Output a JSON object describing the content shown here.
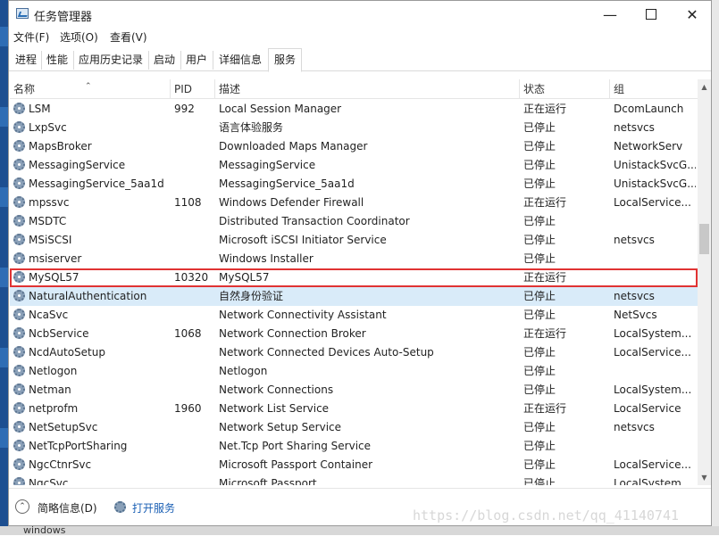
{
  "window": {
    "title": "任务管理器"
  },
  "menu": [
    "文件(F)",
    "选项(O)",
    "查看(V)"
  ],
  "tabs": [
    {
      "label": "进程",
      "active": false
    },
    {
      "label": "性能",
      "active": false
    },
    {
      "label": "应用历史记录",
      "active": false
    },
    {
      "label": "启动",
      "active": false
    },
    {
      "label": "用户",
      "active": false
    },
    {
      "label": "详细信息",
      "active": false
    },
    {
      "label": "服务",
      "active": true
    }
  ],
  "columns": [
    "名称",
    "PID",
    "描述",
    "状态",
    "组"
  ],
  "rows": [
    {
      "name": "LSM",
      "pid": "992",
      "desc": "Local Session Manager",
      "status": "正在运行",
      "group": "DcomLaunch"
    },
    {
      "name": "LxpSvc",
      "pid": "",
      "desc": "语言体验服务",
      "status": "已停止",
      "group": "netsvcs"
    },
    {
      "name": "MapsBroker",
      "pid": "",
      "desc": "Downloaded Maps Manager",
      "status": "已停止",
      "group": "NetworkServ"
    },
    {
      "name": "MessagingService",
      "pid": "",
      "desc": "MessagingService",
      "status": "已停止",
      "group": "UnistackSvcG..."
    },
    {
      "name": "MessagingService_5aa1d",
      "pid": "",
      "desc": "MessagingService_5aa1d",
      "status": "已停止",
      "group": "UnistackSvcG..."
    },
    {
      "name": "mpssvc",
      "pid": "1108",
      "desc": "Windows Defender Firewall",
      "status": "正在运行",
      "group": "LocalService..."
    },
    {
      "name": "MSDTC",
      "pid": "",
      "desc": "Distributed Transaction Coordinator",
      "status": "已停止",
      "group": ""
    },
    {
      "name": "MSiSCSI",
      "pid": "",
      "desc": "Microsoft iSCSI Initiator Service",
      "status": "已停止",
      "group": "netsvcs"
    },
    {
      "name": "msiserver",
      "pid": "",
      "desc": "Windows Installer",
      "status": "已停止",
      "group": ""
    },
    {
      "name": "MySQL57",
      "pid": "10320",
      "desc": "MySQL57",
      "status": "正在运行",
      "group": ""
    },
    {
      "name": "NaturalAuthentication",
      "pid": "",
      "desc": "自然身份验证",
      "status": "已停止",
      "group": "netsvcs"
    },
    {
      "name": "NcaSvc",
      "pid": "",
      "desc": "Network Connectivity Assistant",
      "status": "已停止",
      "group": "NetSvcs"
    },
    {
      "name": "NcbService",
      "pid": "1068",
      "desc": "Network Connection Broker",
      "status": "正在运行",
      "group": "LocalSystem..."
    },
    {
      "name": "NcdAutoSetup",
      "pid": "",
      "desc": "Network Connected Devices Auto-Setup",
      "status": "已停止",
      "group": "LocalService..."
    },
    {
      "name": "Netlogon",
      "pid": "",
      "desc": "Netlogon",
      "status": "已停止",
      "group": ""
    },
    {
      "name": "Netman",
      "pid": "",
      "desc": "Network Connections",
      "status": "已停止",
      "group": "LocalSystem..."
    },
    {
      "name": "netprofm",
      "pid": "1960",
      "desc": "Network List Service",
      "status": "正在运行",
      "group": "LocalService"
    },
    {
      "name": "NetSetupSvc",
      "pid": "",
      "desc": "Network Setup Service",
      "status": "已停止",
      "group": "netsvcs"
    },
    {
      "name": "NetTcpPortSharing",
      "pid": "",
      "desc": "Net.Tcp Port Sharing Service",
      "status": "已停止",
      "group": ""
    },
    {
      "name": "NgcCtnrSvc",
      "pid": "",
      "desc": "Microsoft Passport Container",
      "status": "已停止",
      "group": "LocalService..."
    },
    {
      "name": "NgcSvc",
      "pid": "",
      "desc": "Microsoft Passport",
      "status": "已停止",
      "group": "LocalSystem..."
    }
  ],
  "selected_row": 10,
  "highlighted_row": 9,
  "footer": {
    "fewer_details": "简略信息(D)",
    "open_services": "打开服务"
  },
  "watermark": "https://blog.csdn.net/qq_41140741",
  "desktop_bottom_text": "windows",
  "colors": {
    "selected": "#d9ebf9",
    "highlight_border": "#e03333",
    "link": "#1a5fb4"
  }
}
